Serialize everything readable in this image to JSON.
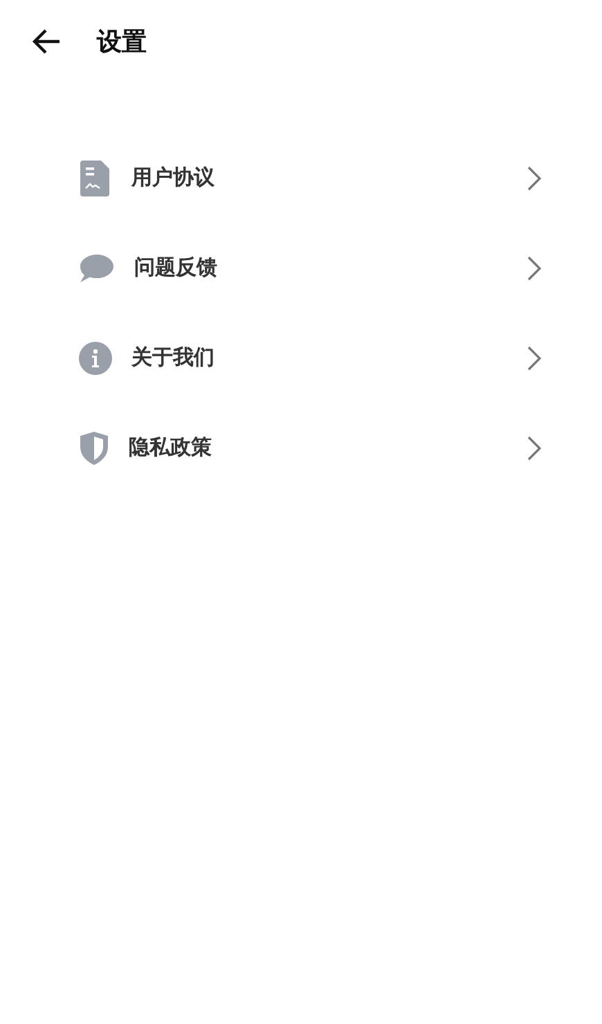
{
  "header": {
    "title": "设置"
  },
  "items": [
    {
      "kind": "document",
      "label": "用户协议"
    },
    {
      "kind": "feedback",
      "label": "问题反馈"
    },
    {
      "kind": "info",
      "label": "关于我们"
    },
    {
      "kind": "privacy",
      "label": "隐私政策"
    }
  ]
}
